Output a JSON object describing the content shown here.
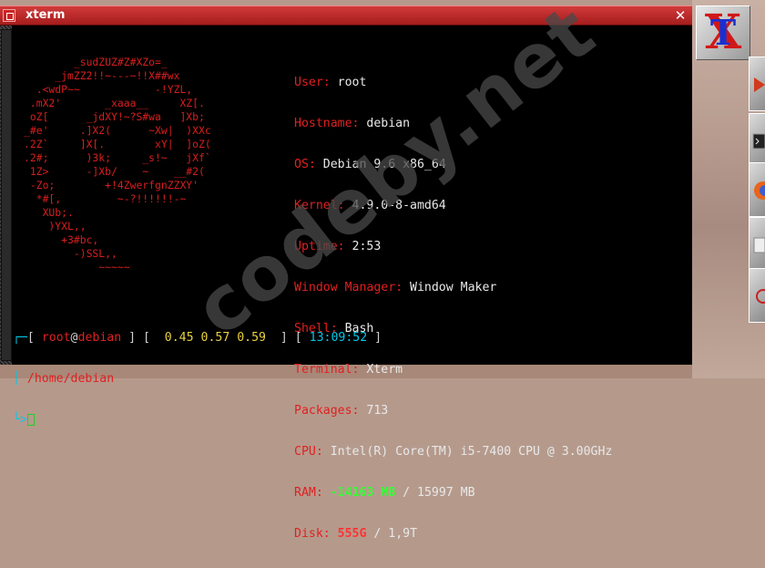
{
  "window": {
    "title": "xterm",
    "close_label": "✕"
  },
  "watermark": "codeby.net",
  "logo_art": "        _sudZUZ#Z#XZo=_\n     _jmZZ2!!~---~!!X##wx\n  .<wdP~~            -!YZL,\n .mX2'       _xaaa__     XZ[.\n oZ[      _jdXY!~?S#wa   ]Xb;\n_#e'     .]X2(      ~Xw|  )XXc\n.2Z`     ]X[.        xY|  ]oZ(\n.2#;      )3k;     _s!~   jXf`\n 1Z>      -]Xb/    ~    __#2(\n -Zo;        +!4ZwerfgnZZXY'\n  *#[,         ~-?!!!!!!-~\n   XUb;.\n    )YXL,,\n      +3#bc,\n        -)SSL,,\n            ~~~~~",
  "info": {
    "user": {
      "key": "User:",
      "value": "root"
    },
    "hostname": {
      "key": "Hostname:",
      "value": "debian"
    },
    "os": {
      "key": "OS:",
      "value": "Debian 9.6 x86_64"
    },
    "kernel": {
      "key": "Kernel:",
      "value": "4.9.0-8-amd64"
    },
    "uptime": {
      "key": "Uptime:",
      "value": "2:53"
    },
    "wm": {
      "key": "Window Manager:",
      "value": "Window Maker"
    },
    "shell": {
      "key": "Shell:",
      "value": "Bash"
    },
    "terminal": {
      "key": "Terminal:",
      "value": "Xterm"
    },
    "packages": {
      "key": "Packages:",
      "value": "713"
    },
    "cpu": {
      "key": "CPU:",
      "value": "Intel(R) Core(TM) i5-7400 CPU @ 3.00GHz"
    },
    "ram": {
      "key": "RAM:",
      "used": "-14163 MB",
      "sep": " / ",
      "total": "15997 MB"
    },
    "disk": {
      "key": "Disk:",
      "used": "555G",
      "sep": " / ",
      "total": "1,9T"
    }
  },
  "prompt": {
    "corner_top": "┌─",
    "open": "[ ",
    "user": "root",
    "at": "@",
    "host": "debian",
    "close": " ]",
    "load_open": " [  ",
    "load1": "0.45",
    "load5": "0.57",
    "load15": "0.59",
    "load_close": "  ]",
    "time_open": " [ ",
    "time": "13:09:52",
    "time_close": " ]",
    "pipe": "│ ",
    "cwd": "/home/debian",
    "corner_bottom": "└>"
  },
  "dock": {
    "xterm_icon": "xterm-x-logo"
  }
}
